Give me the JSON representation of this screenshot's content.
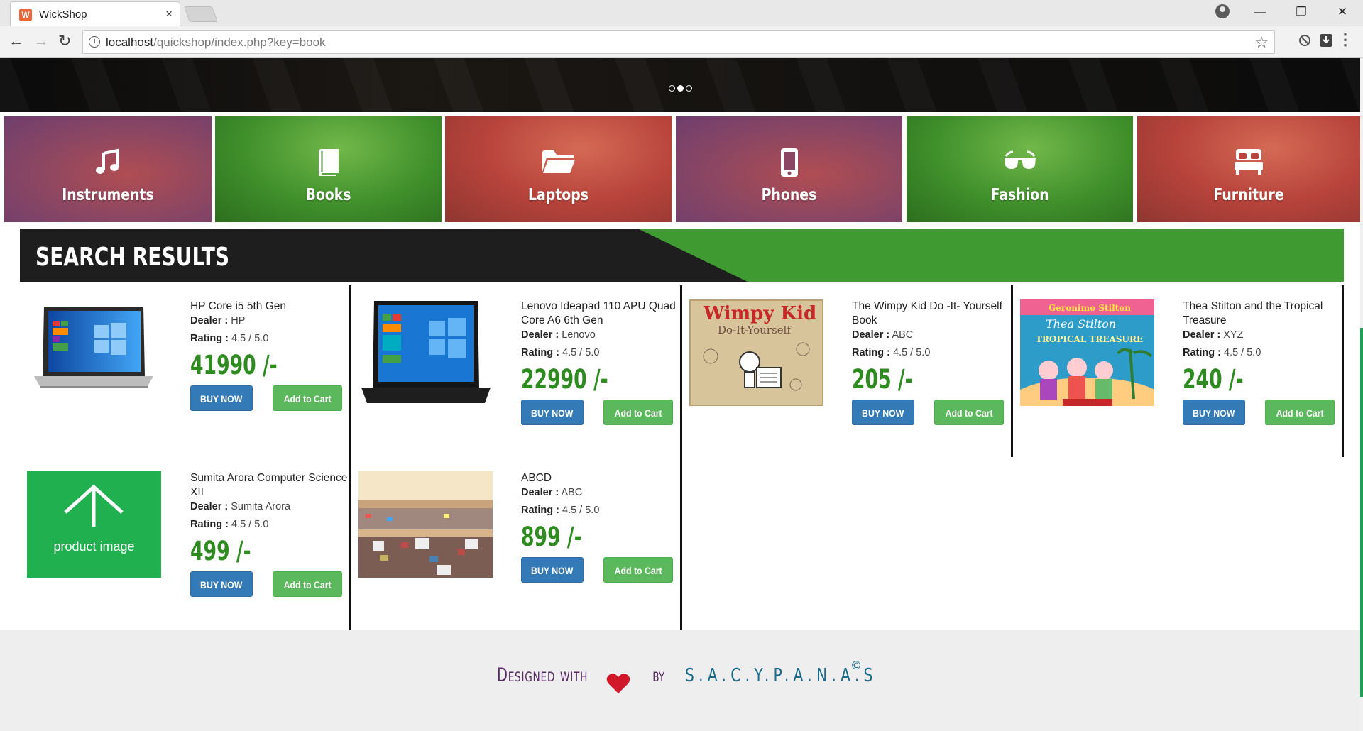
{
  "browser": {
    "tab_title": "WickShop",
    "tab_close": "×",
    "url_host": "localhost",
    "url_path": "/quickshop/index.php?key=book",
    "window_controls": [
      "—",
      "❐",
      "✕"
    ]
  },
  "carousel": {
    "dots": 3,
    "active_dot": 2
  },
  "categories": [
    {
      "label": "Instruments",
      "icon": "music-note-icon",
      "color": "purple"
    },
    {
      "label": "Books",
      "icon": "book-icon",
      "color": "green"
    },
    {
      "label": "Laptops",
      "icon": "folder-open-icon",
      "color": "red"
    },
    {
      "label": "Phones",
      "icon": "mobile-phone-icon",
      "color": "purple"
    },
    {
      "label": "Fashion",
      "icon": "sunglasses-icon",
      "color": "green"
    },
    {
      "label": "Furniture",
      "icon": "bed-icon",
      "color": "red"
    }
  ],
  "results": {
    "heading": "SEARCH RESULTS",
    "buy_label": "BUY NOW",
    "cart_label": "Add to Cart",
    "dealer_label": "Dealer :",
    "rating_label": "Rating :",
    "products": [
      {
        "name": "HP Core i5 5th Gen",
        "dealer": "HP",
        "rating": "4.5 / 5.0",
        "price": "41990 /-",
        "image": "laptop"
      },
      {
        "name": "Lenovo Ideapad 110 APU Quad Core A6 6th Gen",
        "dealer": "Lenovo",
        "rating": "4.5 / 5.0",
        "price": "22990 /-",
        "image": "laptop-dark"
      },
      {
        "name": "The Wimpy Kid Do -It- Yourself Book",
        "dealer": "ABC",
        "rating": "4.5 / 5.0",
        "price": "205 /-",
        "image": "wimpy-kid-book"
      },
      {
        "name": "Thea Stilton and the Tropical Treasure",
        "dealer": "XYZ",
        "rating": "4.5 / 5.0",
        "price": "240 /-",
        "image": "thea-stilton-book"
      },
      {
        "name": "Sumita Arora Computer Science XII",
        "dealer": "Sumita Arora",
        "rating": "4.5 / 5.0",
        "price": "499 /-",
        "image": "placeholder",
        "placeholder_text": "product image"
      },
      {
        "name": "ABCD",
        "dealer": "ABC",
        "rating": "4.5 / 5.0",
        "price": "899 /-",
        "image": "mall"
      }
    ],
    "wimpy_cover_title": "Wimpy Kid",
    "wimpy_cover_subtitle": "Do-It-Yourself",
    "thea_cover_series": "Geronimo Stilton",
    "thea_cover_title": "Thea Stilton",
    "thea_cover_subtitle": "TROPICAL TREASURE"
  },
  "footer": {
    "designed": "Designed with",
    "by": "by",
    "author": "S.A.C.Y.P.A.N.A.S",
    "copyright": "©"
  },
  "colors": {
    "accent_green": "#3f9a32",
    "price_green": "#2e8b1f",
    "buy_blue": "#337ab7",
    "cart_green": "#5cb85c",
    "footer_purple": "#5a2a65",
    "footer_blue": "#1a6a8c"
  }
}
